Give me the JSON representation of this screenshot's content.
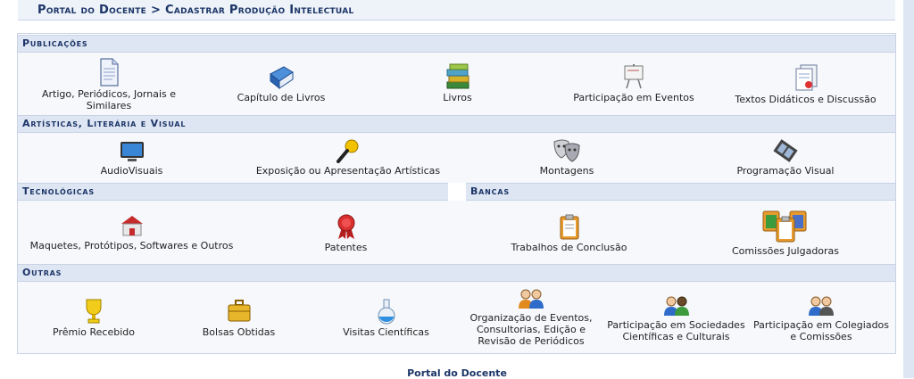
{
  "header": {
    "title": "Portal do Docente > Cadastrar Produção Intelectual"
  },
  "sections": {
    "publicacoes": {
      "title": "Publicações",
      "items": [
        {
          "label": "Artigo, Periódicos, Jornais e Similares",
          "icon": "document-icon"
        },
        {
          "label": "Capítulo de Livros",
          "icon": "blue-book-icon"
        },
        {
          "label": "Livros",
          "icon": "books-stack-icon"
        },
        {
          "label": "Participação em Eventos",
          "icon": "presentation-board-icon"
        },
        {
          "label": "Textos Didáticos e Discussão",
          "icon": "certificate-document-icon"
        }
      ]
    },
    "artisticas": {
      "title": "Artísticas, Literária e Visual",
      "items": [
        {
          "label": "AudioVisuais",
          "icon": "monitor-icon"
        },
        {
          "label": "Exposição ou Apresentação Artísticas",
          "icon": "microphone-icon"
        },
        {
          "label": "Montagens",
          "icon": "theater-masks-icon"
        },
        {
          "label": "Programação Visual",
          "icon": "film-strip-icon"
        }
      ]
    },
    "tecnologicas": {
      "title": "Tecnológicas",
      "items": [
        {
          "label": "Maquetes, Protótipos, Softwares e Outros",
          "icon": "house-model-icon"
        },
        {
          "label": "Patentes",
          "icon": "ribbon-medal-icon"
        }
      ]
    },
    "bancas": {
      "title": "Bancas",
      "items": [
        {
          "label": "Trabalhos de Conclusão",
          "icon": "clipboard-icon"
        },
        {
          "label": "Comissões Julgadoras",
          "icon": "clipboards-group-icon"
        }
      ]
    },
    "outras": {
      "title": "Outras",
      "items": [
        {
          "label": "Prêmio Recebido",
          "icon": "trophy-icon"
        },
        {
          "label": "Bolsas Obtidas",
          "icon": "briefcase-icon"
        },
        {
          "label": "Visitas Científicas",
          "icon": "flask-icon"
        },
        {
          "label": "Organização de Eventos, Consultorias, Edição e Revisão de Periódicos",
          "icon": "people-pair-icon"
        },
        {
          "label": "Participação em Sociedades Científicas e Culturais",
          "icon": "people-group-icon"
        },
        {
          "label": "Participação em Colegiados e Comissões",
          "icon": "people-committee-icon"
        }
      ]
    }
  },
  "footer": {
    "link": "Portal do Docente"
  },
  "colors": {
    "accent": "#1b3567",
    "section_bg": "#dfe6f3",
    "row_bg": "#f6f8fb"
  }
}
